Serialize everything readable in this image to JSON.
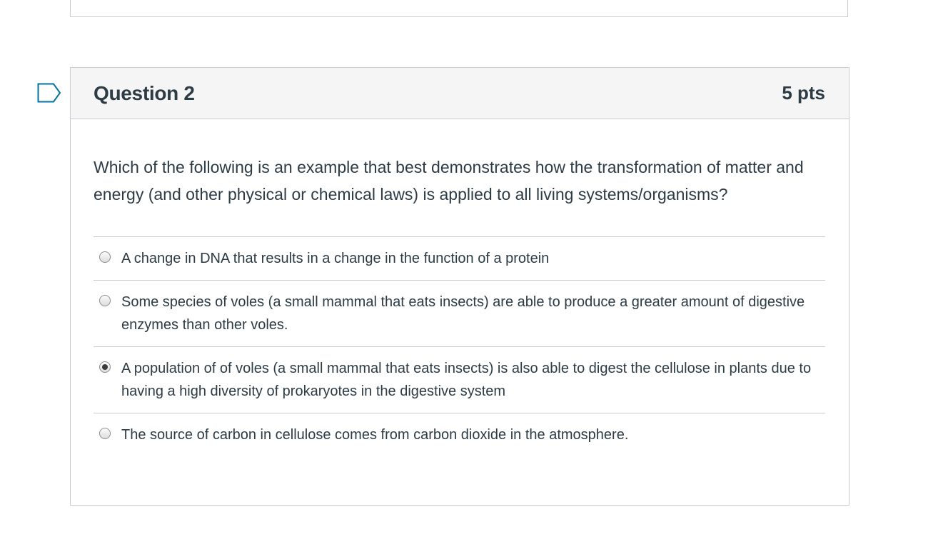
{
  "question": {
    "title": "Question 2",
    "points": "5 pts",
    "text": "Which of the following is an example that best demonstrates how the transformation of matter and energy (and other physical or chemical laws) is applied to all living systems/organisms?",
    "flag_icon": "bookmark-flag-icon",
    "answers": [
      {
        "label": "A change in DNA that results in a change in the function of a protein",
        "selected": false
      },
      {
        "label": "Some species of voles (a small mammal that eats insects) are able to produce a greater amount of digestive enzymes than other voles.",
        "selected": false
      },
      {
        "label": "A population of of voles (a small mammal that eats insects) is also able to digest the cellulose in plants due to having a high diversity of prokaryotes in the digestive system",
        "selected": true
      },
      {
        "label": "The source of carbon in cellulose comes from carbon dioxide in the atmosphere.",
        "selected": false
      }
    ]
  },
  "colors": {
    "text": "#2d3b45",
    "border": "#c7cdd1",
    "header_bg": "#f5f5f5",
    "flag": "#0770a3"
  }
}
